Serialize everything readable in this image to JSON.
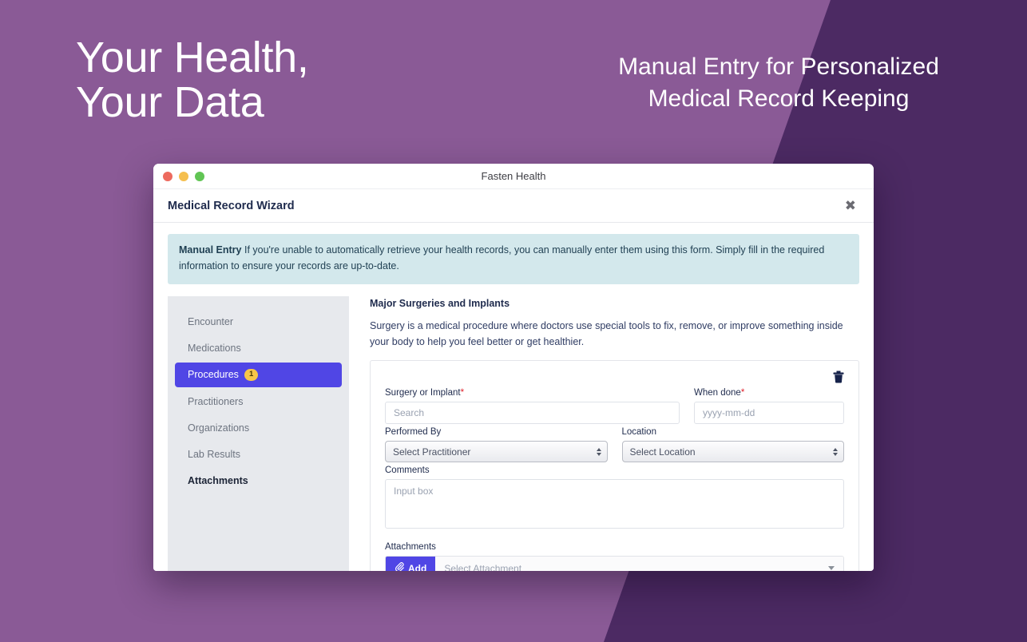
{
  "hero": {
    "headline_left": "Your Health,\nYour Data",
    "headline_right": "Manual Entry for Personalized\nMedical Record Keeping",
    "bg_light": "#8a5a96",
    "bg_dark": "#4c2a63"
  },
  "window": {
    "title": "Fasten Health",
    "traffic_lights": [
      "close",
      "minimize",
      "zoom"
    ]
  },
  "wizard": {
    "title": "Medical Record Wizard",
    "close_label": "✖",
    "alert": {
      "bold": "Manual Entry",
      "text": " If you're unable to automatically retrieve your health records, you can manually enter them using this form. Simply fill in the required information to ensure your records are up-to-date."
    }
  },
  "sidebar": {
    "items": [
      {
        "label": "Encounter",
        "active": false,
        "badge": null
      },
      {
        "label": "Medications",
        "active": false,
        "badge": null
      },
      {
        "label": "Procedures",
        "active": true,
        "badge": "1"
      },
      {
        "label": "Practitioners",
        "active": false,
        "badge": null
      },
      {
        "label": "Organizations",
        "active": false,
        "badge": null
      },
      {
        "label": "Lab Results",
        "active": false,
        "badge": null
      },
      {
        "label": "Attachments",
        "active": false,
        "badge": null
      }
    ],
    "active_color": "#5046e5",
    "badge_color": "#f7c548"
  },
  "section": {
    "title": "Major Surgeries and Implants",
    "description": "Surgery is a medical procedure where doctors use special tools to fix, remove, or improve something inside your body to help you feel better or get healthier."
  },
  "form": {
    "delete_icon": "trash-icon",
    "surgery": {
      "label": "Surgery or Implant",
      "required_mark": "*",
      "value": "",
      "placeholder": "Search"
    },
    "when_done": {
      "label": "When done",
      "required_mark": "*",
      "value": "",
      "placeholder": "yyyy-mm-dd"
    },
    "performed_by": {
      "label": "Performed By",
      "selected": "Select Practitioner"
    },
    "location": {
      "label": "Location",
      "selected": "Select Location"
    },
    "comments": {
      "label": "Comments",
      "value": "",
      "placeholder": "Input box"
    },
    "attachments": {
      "label": "Attachments",
      "add_button": "Add",
      "add_icon": "paperclip-icon",
      "selected": "Select Attachment"
    }
  }
}
